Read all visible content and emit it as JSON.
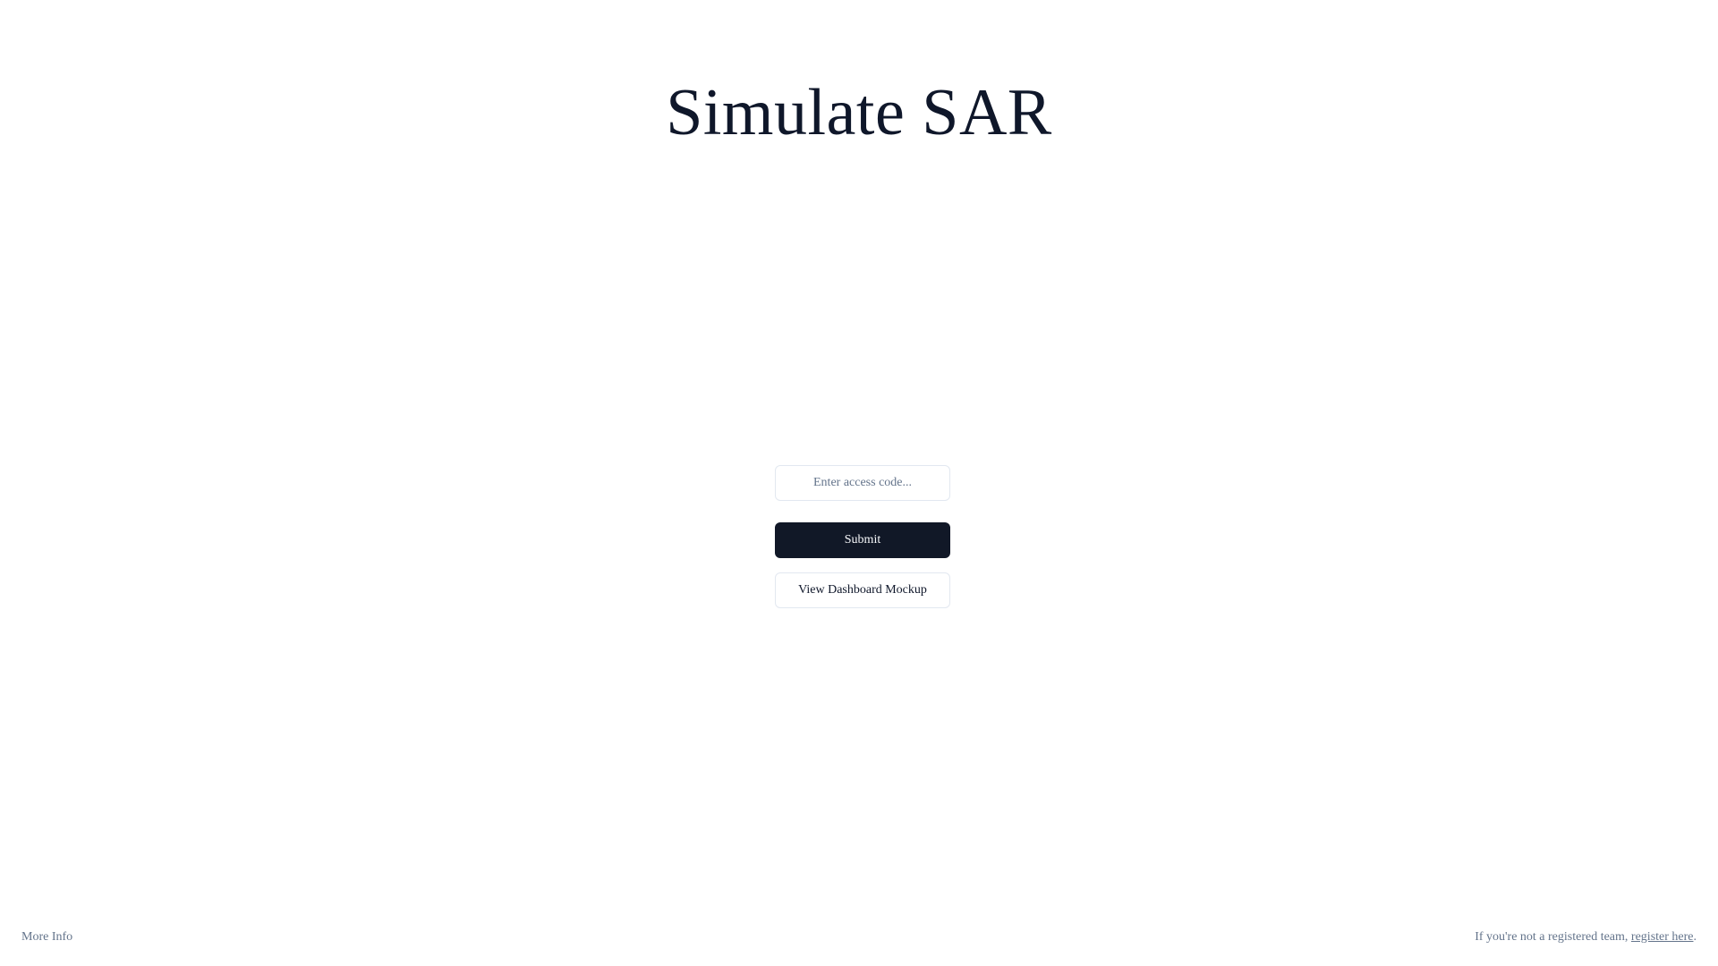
{
  "header": {
    "title": "Simulate SAR"
  },
  "form": {
    "access_code_placeholder": "Enter access code...",
    "access_code_value": "",
    "submit_label": "Submit",
    "mockup_label": "View Dashboard Mockup"
  },
  "footer": {
    "more_info_label": "More Info",
    "register_prefix": "If you're not a registered team, ",
    "register_link_label": "register here",
    "register_suffix": "."
  },
  "colors": {
    "primary_button": "#111827",
    "muted_text": "#64748b",
    "border": "#e2e8f0",
    "title": "#0f172a"
  }
}
